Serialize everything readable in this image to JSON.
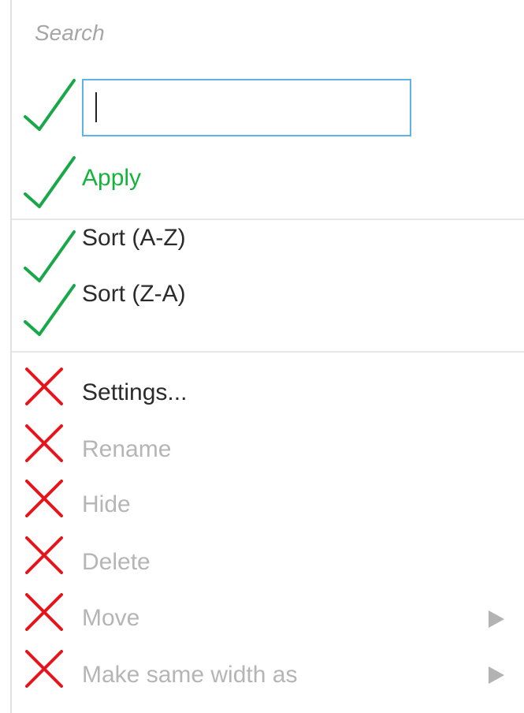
{
  "search": {
    "label": "Search",
    "value": "",
    "input_border_color": "#5fb4e6"
  },
  "apply_label": "Apply",
  "sort": {
    "az_label": "Sort (A-Z)",
    "za_label": "Sort (Z-A)"
  },
  "menu": {
    "settings_label": "Settings...",
    "rename_label": "Rename",
    "hide_label": "Hide",
    "delete_label": "Delete",
    "move_label": "Move",
    "same_width_label": "Make same width as"
  },
  "annotations": {
    "check_icon": "check-mark",
    "cross_icon": "x-mark",
    "check_color": "#18a84a",
    "cross_color": "#e8141b"
  },
  "colors": {
    "apply": "#16b33c",
    "enabled_text": "#2b2b2b",
    "disabled_text": "#b5b5b5",
    "submenu_arrow": "#b3b3b3"
  }
}
